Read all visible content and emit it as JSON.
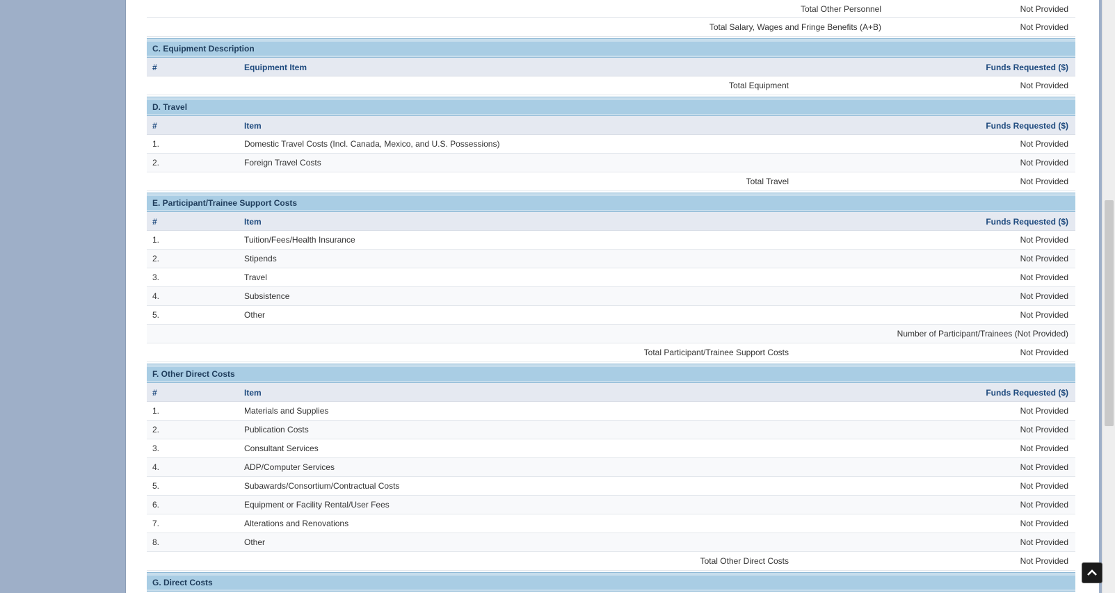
{
  "top_rows": [
    {
      "label": "Total Other Personnel",
      "value": "Not Provided"
    },
    {
      "label": "Total Salary, Wages and Fringe Benefits (A+B)",
      "value": "Not Provided"
    }
  ],
  "sections": {
    "equipment": {
      "title": "C. Equipment Description",
      "columns": {
        "num": "#",
        "item": "Equipment Item",
        "funds": "Funds Requested ($)"
      },
      "total": {
        "label": "Total Equipment",
        "value": "Not Provided"
      }
    },
    "travel": {
      "title": "D. Travel",
      "columns": {
        "num": "#",
        "item": "Item",
        "funds": "Funds Requested ($)"
      },
      "rows": [
        {
          "num": "1.",
          "item": "Domestic Travel Costs (Incl. Canada, Mexico, and U.S. Possessions)",
          "value": "Not Provided"
        },
        {
          "num": "2.",
          "item": "Foreign Travel Costs",
          "value": "Not Provided"
        }
      ],
      "total": {
        "label": "Total Travel",
        "value": "Not Provided"
      }
    },
    "participant": {
      "title": "E. Participant/Trainee Support Costs",
      "columns": {
        "num": "#",
        "item": "Item",
        "funds": "Funds Requested ($)"
      },
      "rows": [
        {
          "num": "1.",
          "item": "Tuition/Fees/Health Insurance",
          "value": "Not Provided"
        },
        {
          "num": "2.",
          "item": "Stipends",
          "value": "Not Provided"
        },
        {
          "num": "3.",
          "item": "Travel",
          "value": "Not Provided"
        },
        {
          "num": "4.",
          "item": "Subsistence",
          "value": "Not Provided"
        },
        {
          "num": "5.",
          "item": "Other",
          "value": "Not Provided"
        }
      ],
      "participants_note": "Number of Participant/Trainees (Not Provided)",
      "total": {
        "label": "Total Participant/Trainee Support Costs",
        "value": "Not Provided"
      }
    },
    "other_direct": {
      "title": "F. Other Direct Costs",
      "columns": {
        "num": "#",
        "item": "Item",
        "funds": "Funds Requested ($)"
      },
      "rows": [
        {
          "num": "1.",
          "item": "Materials and Supplies",
          "value": "Not Provided"
        },
        {
          "num": "2.",
          "item": "Publication Costs",
          "value": "Not Provided"
        },
        {
          "num": "3.",
          "item": "Consultant Services",
          "value": "Not Provided"
        },
        {
          "num": "4.",
          "item": "ADP/Computer Services",
          "value": "Not Provided"
        },
        {
          "num": "5.",
          "item": "Subawards/Consortium/Contractual Costs",
          "value": "Not Provided"
        },
        {
          "num": "6.",
          "item": "Equipment or Facility Rental/User Fees",
          "value": "Not Provided"
        },
        {
          "num": "7.",
          "item": "Alterations and Renovations",
          "value": "Not Provided"
        },
        {
          "num": "8.",
          "item": "Other",
          "value": "Not Provided"
        }
      ],
      "total": {
        "label": "Total Other Direct Costs",
        "value": "Not Provided"
      }
    },
    "direct": {
      "title": "G. Direct Costs"
    }
  },
  "icons": {
    "back_to_top": "chevron-up-icon"
  }
}
